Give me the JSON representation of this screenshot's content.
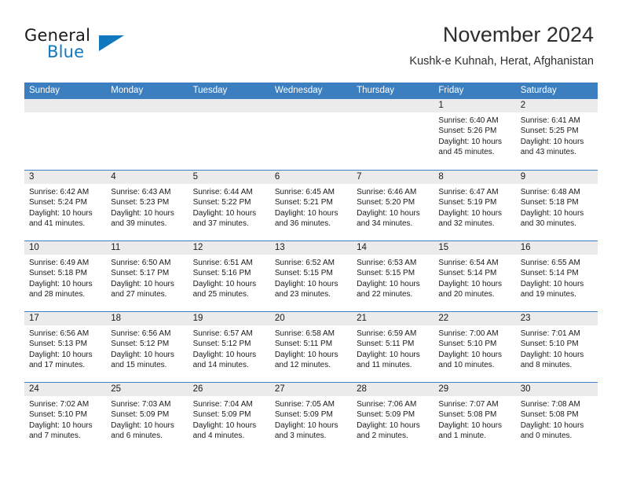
{
  "brand": {
    "name_part1": "General",
    "name_part2": "Blue",
    "mark_icon": "triangle-logo-icon",
    "accent_color": "#1278be"
  },
  "header": {
    "title": "November 2024",
    "subtitle": "Kushk-e Kuhnah, Herat, Afghanistan"
  },
  "theme": {
    "header_bar_color": "#3c7fc1",
    "day_band_color": "#ebebeb",
    "text_color": "#1a1a1a"
  },
  "weekdays": [
    "Sunday",
    "Monday",
    "Tuesday",
    "Wednesday",
    "Thursday",
    "Friday",
    "Saturday"
  ],
  "weeks": [
    {
      "days": [
        {
          "date": "",
          "empty": true,
          "sunrise": "",
          "sunset": "",
          "daylight_line1": "",
          "daylight_line2": ""
        },
        {
          "date": "",
          "empty": true,
          "sunrise": "",
          "sunset": "",
          "daylight_line1": "",
          "daylight_line2": ""
        },
        {
          "date": "",
          "empty": true,
          "sunrise": "",
          "sunset": "",
          "daylight_line1": "",
          "daylight_line2": ""
        },
        {
          "date": "",
          "empty": true,
          "sunrise": "",
          "sunset": "",
          "daylight_line1": "",
          "daylight_line2": ""
        },
        {
          "date": "",
          "empty": true,
          "sunrise": "",
          "sunset": "",
          "daylight_line1": "",
          "daylight_line2": ""
        },
        {
          "date": "1",
          "empty": false,
          "sunrise": "Sunrise: 6:40 AM",
          "sunset": "Sunset: 5:26 PM",
          "daylight_line1": "Daylight: 10 hours",
          "daylight_line2": "and 45 minutes."
        },
        {
          "date": "2",
          "empty": false,
          "sunrise": "Sunrise: 6:41 AM",
          "sunset": "Sunset: 5:25 PM",
          "daylight_line1": "Daylight: 10 hours",
          "daylight_line2": "and 43 minutes."
        }
      ]
    },
    {
      "days": [
        {
          "date": "3",
          "empty": false,
          "sunrise": "Sunrise: 6:42 AM",
          "sunset": "Sunset: 5:24 PM",
          "daylight_line1": "Daylight: 10 hours",
          "daylight_line2": "and 41 minutes."
        },
        {
          "date": "4",
          "empty": false,
          "sunrise": "Sunrise: 6:43 AM",
          "sunset": "Sunset: 5:23 PM",
          "daylight_line1": "Daylight: 10 hours",
          "daylight_line2": "and 39 minutes."
        },
        {
          "date": "5",
          "empty": false,
          "sunrise": "Sunrise: 6:44 AM",
          "sunset": "Sunset: 5:22 PM",
          "daylight_line1": "Daylight: 10 hours",
          "daylight_line2": "and 37 minutes."
        },
        {
          "date": "6",
          "empty": false,
          "sunrise": "Sunrise: 6:45 AM",
          "sunset": "Sunset: 5:21 PM",
          "daylight_line1": "Daylight: 10 hours",
          "daylight_line2": "and 36 minutes."
        },
        {
          "date": "7",
          "empty": false,
          "sunrise": "Sunrise: 6:46 AM",
          "sunset": "Sunset: 5:20 PM",
          "daylight_line1": "Daylight: 10 hours",
          "daylight_line2": "and 34 minutes."
        },
        {
          "date": "8",
          "empty": false,
          "sunrise": "Sunrise: 6:47 AM",
          "sunset": "Sunset: 5:19 PM",
          "daylight_line1": "Daylight: 10 hours",
          "daylight_line2": "and 32 minutes."
        },
        {
          "date": "9",
          "empty": false,
          "sunrise": "Sunrise: 6:48 AM",
          "sunset": "Sunset: 5:18 PM",
          "daylight_line1": "Daylight: 10 hours",
          "daylight_line2": "and 30 minutes."
        }
      ]
    },
    {
      "days": [
        {
          "date": "10",
          "empty": false,
          "sunrise": "Sunrise: 6:49 AM",
          "sunset": "Sunset: 5:18 PM",
          "daylight_line1": "Daylight: 10 hours",
          "daylight_line2": "and 28 minutes."
        },
        {
          "date": "11",
          "empty": false,
          "sunrise": "Sunrise: 6:50 AM",
          "sunset": "Sunset: 5:17 PM",
          "daylight_line1": "Daylight: 10 hours",
          "daylight_line2": "and 27 minutes."
        },
        {
          "date": "12",
          "empty": false,
          "sunrise": "Sunrise: 6:51 AM",
          "sunset": "Sunset: 5:16 PM",
          "daylight_line1": "Daylight: 10 hours",
          "daylight_line2": "and 25 minutes."
        },
        {
          "date": "13",
          "empty": false,
          "sunrise": "Sunrise: 6:52 AM",
          "sunset": "Sunset: 5:15 PM",
          "daylight_line1": "Daylight: 10 hours",
          "daylight_line2": "and 23 minutes."
        },
        {
          "date": "14",
          "empty": false,
          "sunrise": "Sunrise: 6:53 AM",
          "sunset": "Sunset: 5:15 PM",
          "daylight_line1": "Daylight: 10 hours",
          "daylight_line2": "and 22 minutes."
        },
        {
          "date": "15",
          "empty": false,
          "sunrise": "Sunrise: 6:54 AM",
          "sunset": "Sunset: 5:14 PM",
          "daylight_line1": "Daylight: 10 hours",
          "daylight_line2": "and 20 minutes."
        },
        {
          "date": "16",
          "empty": false,
          "sunrise": "Sunrise: 6:55 AM",
          "sunset": "Sunset: 5:14 PM",
          "daylight_line1": "Daylight: 10 hours",
          "daylight_line2": "and 19 minutes."
        }
      ]
    },
    {
      "days": [
        {
          "date": "17",
          "empty": false,
          "sunrise": "Sunrise: 6:56 AM",
          "sunset": "Sunset: 5:13 PM",
          "daylight_line1": "Daylight: 10 hours",
          "daylight_line2": "and 17 minutes."
        },
        {
          "date": "18",
          "empty": false,
          "sunrise": "Sunrise: 6:56 AM",
          "sunset": "Sunset: 5:12 PM",
          "daylight_line1": "Daylight: 10 hours",
          "daylight_line2": "and 15 minutes."
        },
        {
          "date": "19",
          "empty": false,
          "sunrise": "Sunrise: 6:57 AM",
          "sunset": "Sunset: 5:12 PM",
          "daylight_line1": "Daylight: 10 hours",
          "daylight_line2": "and 14 minutes."
        },
        {
          "date": "20",
          "empty": false,
          "sunrise": "Sunrise: 6:58 AM",
          "sunset": "Sunset: 5:11 PM",
          "daylight_line1": "Daylight: 10 hours",
          "daylight_line2": "and 12 minutes."
        },
        {
          "date": "21",
          "empty": false,
          "sunrise": "Sunrise: 6:59 AM",
          "sunset": "Sunset: 5:11 PM",
          "daylight_line1": "Daylight: 10 hours",
          "daylight_line2": "and 11 minutes."
        },
        {
          "date": "22",
          "empty": false,
          "sunrise": "Sunrise: 7:00 AM",
          "sunset": "Sunset: 5:10 PM",
          "daylight_line1": "Daylight: 10 hours",
          "daylight_line2": "and 10 minutes."
        },
        {
          "date": "23",
          "empty": false,
          "sunrise": "Sunrise: 7:01 AM",
          "sunset": "Sunset: 5:10 PM",
          "daylight_line1": "Daylight: 10 hours",
          "daylight_line2": "and 8 minutes."
        }
      ]
    },
    {
      "days": [
        {
          "date": "24",
          "empty": false,
          "sunrise": "Sunrise: 7:02 AM",
          "sunset": "Sunset: 5:10 PM",
          "daylight_line1": "Daylight: 10 hours",
          "daylight_line2": "and 7 minutes."
        },
        {
          "date": "25",
          "empty": false,
          "sunrise": "Sunrise: 7:03 AM",
          "sunset": "Sunset: 5:09 PM",
          "daylight_line1": "Daylight: 10 hours",
          "daylight_line2": "and 6 minutes."
        },
        {
          "date": "26",
          "empty": false,
          "sunrise": "Sunrise: 7:04 AM",
          "sunset": "Sunset: 5:09 PM",
          "daylight_line1": "Daylight: 10 hours",
          "daylight_line2": "and 4 minutes."
        },
        {
          "date": "27",
          "empty": false,
          "sunrise": "Sunrise: 7:05 AM",
          "sunset": "Sunset: 5:09 PM",
          "daylight_line1": "Daylight: 10 hours",
          "daylight_line2": "and 3 minutes."
        },
        {
          "date": "28",
          "empty": false,
          "sunrise": "Sunrise: 7:06 AM",
          "sunset": "Sunset: 5:09 PM",
          "daylight_line1": "Daylight: 10 hours",
          "daylight_line2": "and 2 minutes."
        },
        {
          "date": "29",
          "empty": false,
          "sunrise": "Sunrise: 7:07 AM",
          "sunset": "Sunset: 5:08 PM",
          "daylight_line1": "Daylight: 10 hours",
          "daylight_line2": "and 1 minute."
        },
        {
          "date": "30",
          "empty": false,
          "sunrise": "Sunrise: 7:08 AM",
          "sunset": "Sunset: 5:08 PM",
          "daylight_line1": "Daylight: 10 hours",
          "daylight_line2": "and 0 minutes."
        }
      ]
    }
  ]
}
